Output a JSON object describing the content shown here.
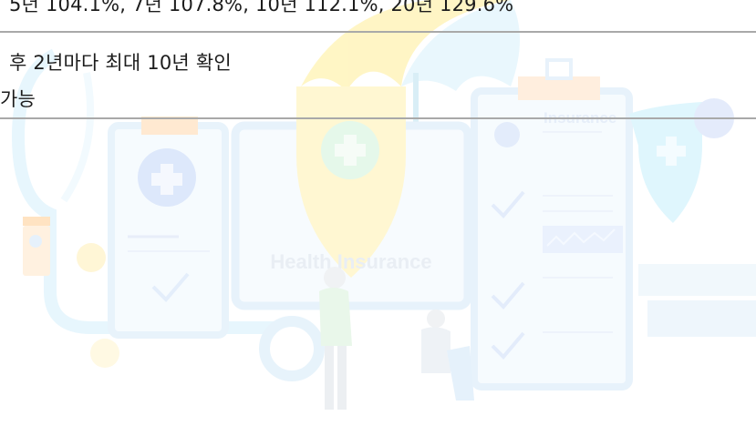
{
  "table": {
    "row1": "5년 104.1%, 7년 107.8%, 10년 112.1%, 20년 129.6%",
    "row2_line1": "후 2년마다 최대 10년 확인",
    "row2_line2": "가능"
  },
  "illustration": {
    "badge_text": "Health Insurance",
    "clipboard_heading": "Insurance"
  },
  "colors": {
    "rule": "#a9a9a9",
    "text": "#1c1c1c",
    "clipboard_blue": "#cfe2ff",
    "umbrella_yellow": "#fff3b8",
    "accent_teal": "#d7f4fb"
  },
  "icons": [
    "stethoscope-icon",
    "clipboard-icon",
    "umbrella-icon",
    "shield-cross-icon",
    "dollar-icon",
    "medicine-bottle-icon",
    "person-icon",
    "checkmark-icon"
  ]
}
